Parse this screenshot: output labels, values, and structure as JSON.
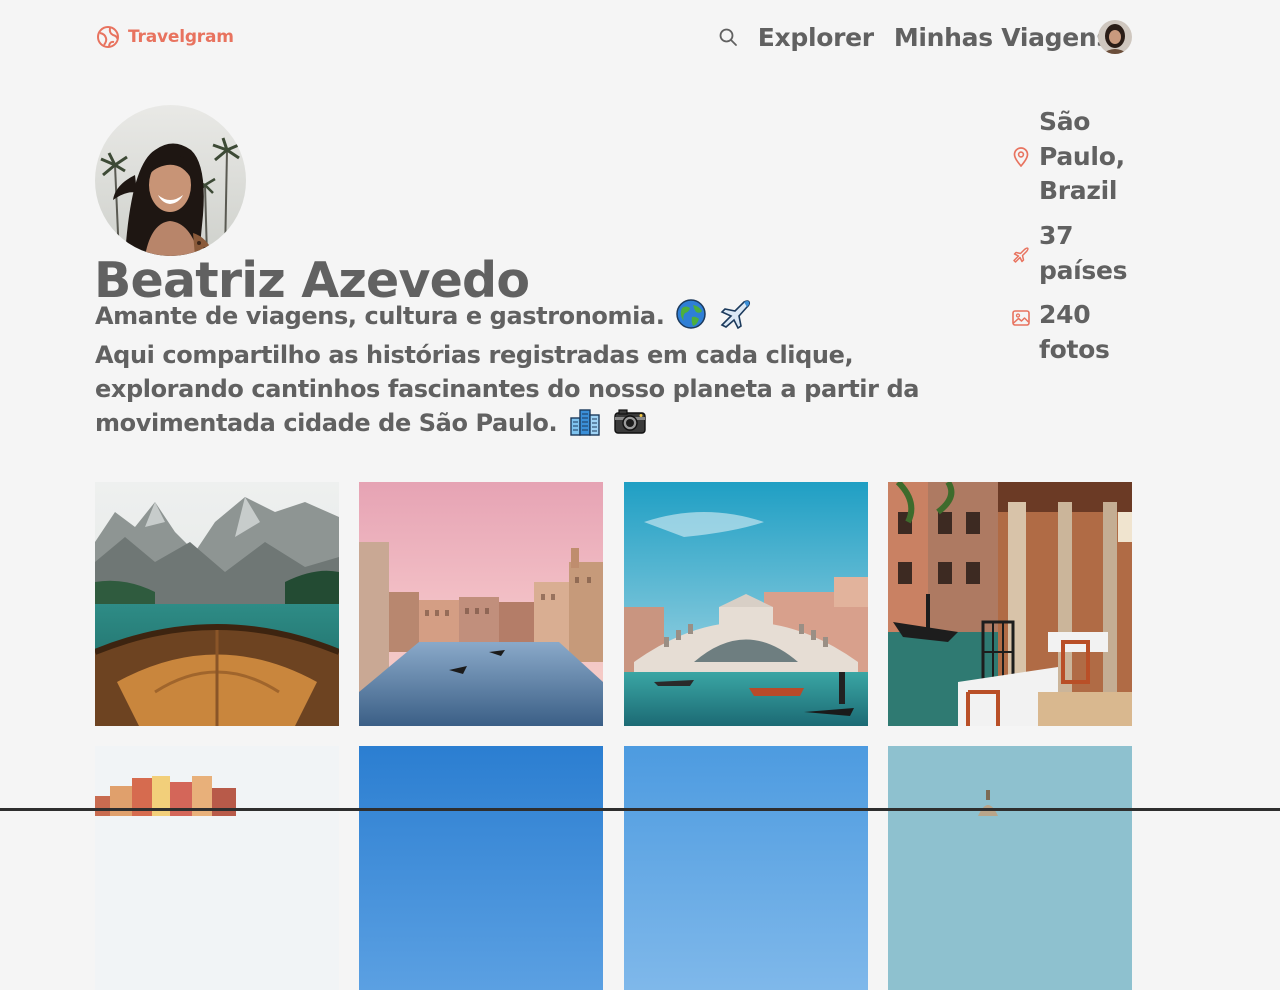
{
  "app": {
    "name": "Travelgram",
    "accent_color": "#e8735f",
    "text_color": "#616161",
    "background": "#f5f5f5"
  },
  "header": {
    "logo_icon": "globe-icon",
    "search_icon": "search-icon",
    "nav": [
      {
        "label": "Explorer"
      },
      {
        "label": "Minhas Viagens"
      }
    ],
    "avatar_icon": "user-avatar"
  },
  "profile": {
    "name": "Beatriz Azevedo",
    "bio_line1": "Amante de viagens, cultura e gastronomia.",
    "bio_line1_emojis": [
      "globe-icon",
      "airplane-icon"
    ],
    "bio_line2": "Aqui compartilho as histórias registradas em cada clique, explorando cantinhos fascinantes do nosso planeta a partir da movimentada cidade de São Paulo.",
    "bio_line2_emojis": [
      "city-icon",
      "camera-icon"
    ]
  },
  "stats": [
    {
      "icon": "location-pin-icon",
      "text": "São Paulo, Brazil"
    },
    {
      "icon": "airplane-icon",
      "text": "37 países"
    },
    {
      "icon": "image-icon",
      "text": "240 fotos"
    }
  ],
  "gallery": [
    {
      "subject": "lake-boat-mountains"
    },
    {
      "subject": "venice-canal-sunset"
    },
    {
      "subject": "rialto-bridge"
    },
    {
      "subject": "venice-canal-restaurant"
    },
    {
      "subject": "cinque-terre-houses"
    },
    {
      "subject": "blue-sky-1"
    },
    {
      "subject": "blue-sky-2"
    },
    {
      "subject": "church-dome-sky"
    }
  ]
}
